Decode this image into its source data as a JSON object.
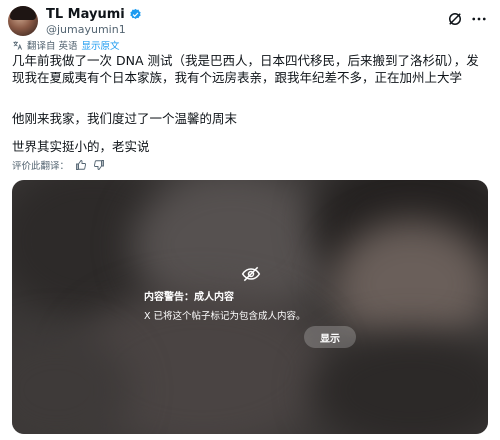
{
  "author": {
    "display_name": "TL Mayumi",
    "handle": "@jumayumin1"
  },
  "translate_bar": {
    "label": "翻译自 英语",
    "show_original": "显示原文"
  },
  "post": {
    "paragraph_1": "几年前我做了一次 DNA 测试（我是巴西人，日本四代移民，后来搬到了洛杉矶），发现我在夏威夷有个日本家族，我有个远房表亲，跟我年纪差不多，正在加州上大学",
    "paragraph_2": "他刚来我家，我们度过了一个温馨的周末",
    "paragraph_3": "世界其实挺小的，老实说"
  },
  "rate_translation": {
    "label": "评价此翻译："
  },
  "media": {
    "warning_title": "内容警告：成人内容",
    "warning_description": "X 已将这个帖子标记为包含成人内容。",
    "show_label": "显示"
  },
  "colors": {
    "accent": "#1d9bf0",
    "verified": "#1d9bf0",
    "secondary_text": "#536471"
  }
}
